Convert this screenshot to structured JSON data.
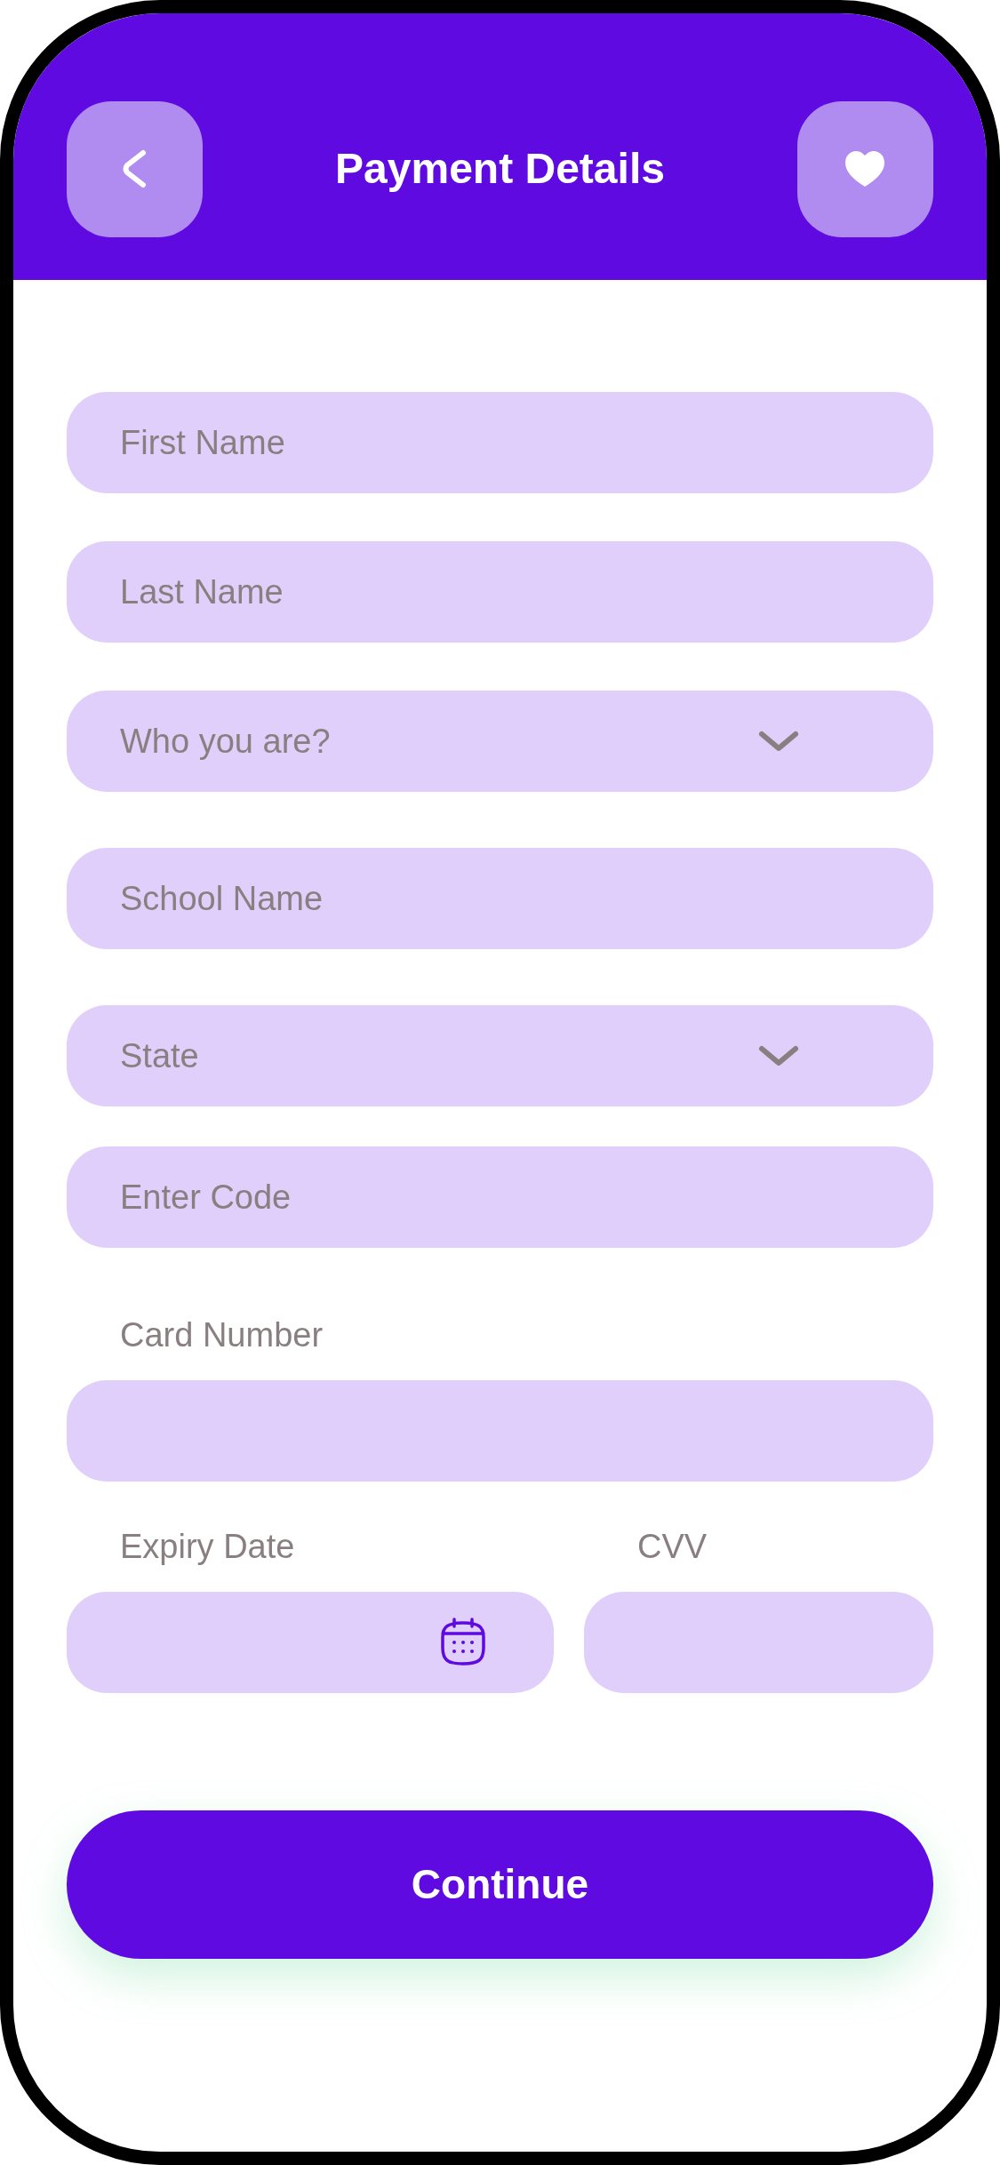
{
  "header": {
    "title": "Payment Details"
  },
  "fields": [
    {
      "kind": "input",
      "placeholder": "First Name"
    },
    {
      "kind": "input",
      "placeholder": "Last Name"
    },
    {
      "kind": "select",
      "placeholder": "Who you are?"
    },
    {
      "kind": "input",
      "placeholder": "School Name"
    },
    {
      "kind": "select",
      "placeholder": "State"
    },
    {
      "kind": "input",
      "placeholder": "Enter Code"
    }
  ],
  "card_number": {
    "label": "Card Number"
  },
  "expiry_date": {
    "label": "Expiry Date"
  },
  "cvv": {
    "label": "CVV"
  },
  "continue_button": {
    "label": "Continue"
  }
}
